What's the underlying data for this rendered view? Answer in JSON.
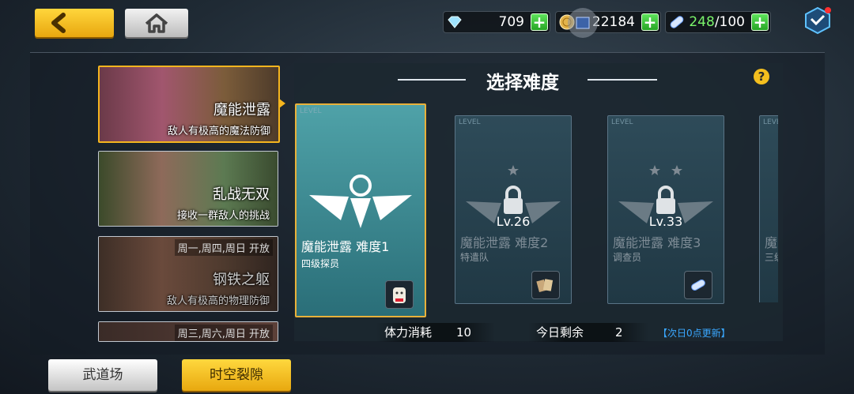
{
  "nav": {
    "back_icon": "chevron-left-icon",
    "home_icon": "home-icon"
  },
  "resources": {
    "gems": {
      "value": "709",
      "icon": "diamond-icon"
    },
    "gold": {
      "value": "22184",
      "icon": "coin-icon"
    },
    "stamina": {
      "current": "248",
      "max": "/100",
      "icon": "stamina-pill-icon"
    }
  },
  "modes": [
    {
      "title": "魔能泄露",
      "subtitle": "敌人有极高的魔法防御",
      "open": ""
    },
    {
      "title": "乱战无双",
      "subtitle": "接收一群敌人的挑战",
      "open": ""
    },
    {
      "title": "钢铁之躯",
      "subtitle": "敌人有极高的物理防御",
      "open": "周一,周四,周日 开放"
    },
    {
      "title": "",
      "subtitle": "",
      "open": "周三,周六,周日 开放"
    }
  ],
  "panel": {
    "title": "选择难度",
    "help": "?"
  },
  "difficulties": [
    {
      "tag": "LEVEL",
      "name": "魔能泄露 难度1",
      "rank": "四级探员",
      "lock_level": ""
    },
    {
      "tag": "LEVEL",
      "name": "魔能泄露 难度2",
      "rank": "特遣队",
      "lock_level": "Lv.26"
    },
    {
      "tag": "LEVEL",
      "name": "魔能泄露 难度3",
      "rank": "调查员",
      "lock_level": "Lv.33"
    },
    {
      "tag": "LEVEL",
      "name": "魔",
      "rank": "三级",
      "lock_level": ""
    }
  ],
  "stats": {
    "cost_label": "体力消耗",
    "cost_value": "10",
    "remain_label": "今日剩余",
    "remain_value": "2",
    "refresh_note": "【次日0点更新】"
  },
  "tabs": {
    "dojo": "武道场",
    "rift": "时空裂隙"
  },
  "colors": {
    "accent": "#f5b51e",
    "plus": "#3dc338",
    "stamina": "#7af46b",
    "link": "#3aa7ff"
  }
}
